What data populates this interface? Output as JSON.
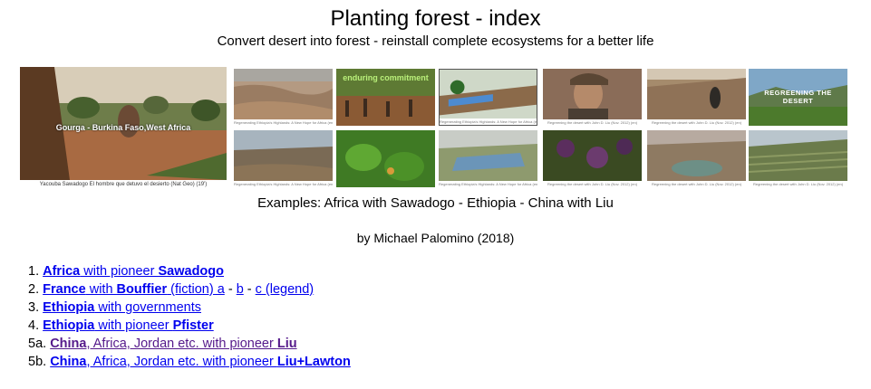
{
  "header": {
    "title": "Planting forest - index",
    "subtitle": "Convert desert into forest - reinstall complete ecosystems for a better life"
  },
  "hero": {
    "overlay_text": "Gourga - Burkina Faso,West Africa",
    "caption": "Yacouba Sawadogo El hombre que detuvo el desierto (Nat Geo)  (19')"
  },
  "thumbs": [
    {
      "caption": "Regenerating Ethiopia's Highlands: A New Hope for Africa (en)"
    },
    {
      "caption": "",
      "overlay": "enduring commitment"
    },
    {
      "caption": "Regenerating Ethiopia's Highlands: A New Hope for Africa (en)"
    },
    {
      "caption": "Regreening the desert with John D. Liu (Nov. 2012) (en)"
    },
    {
      "caption": "Regreening the desert with John D. Liu (Nov. 2012) (en)"
    },
    {
      "caption": "",
      "overlay": "REGREENING THE DESERT"
    },
    {
      "caption": "Regenerating Ethiopia's Highlands: A New Hope for Africa (en)"
    },
    {
      "caption": ""
    },
    {
      "caption": "Regenerating Ethiopia's Highlands: A New Hope for Africa (en)"
    },
    {
      "caption": "Regreening the desert with John D. Liu (Nov. 2012) (en)"
    },
    {
      "caption": "Regreening the desert with John D. Liu (Nov. 2012) (en)"
    },
    {
      "caption": "Regreening the desert with John D. Liu (Nov. 2012) (en)"
    }
  ],
  "examples": "Examples: Africa with Sawadogo - Ethiopia - China with Liu",
  "byline": "by Michael Palomino (2018)",
  "list": [
    {
      "num": "1.",
      "parts": [
        "Africa",
        " with pioneer ",
        "Sawadogo"
      ]
    },
    {
      "num": "2.",
      "parts": [
        "France",
        " with ",
        "Bouffier",
        " (fiction) a",
        " - ",
        "b",
        " - ",
        "c (legend)"
      ]
    },
    {
      "num": "3.",
      "parts": [
        "Ethiopia",
        " with governments"
      ]
    },
    {
      "num": "4.",
      "parts": [
        "Ethiopia",
        " with pioneer ",
        "Pfister"
      ]
    },
    {
      "num": "5a.",
      "parts": [
        "China",
        ", Africa, Jordan etc. with pioneer ",
        "Liu"
      ]
    },
    {
      "num": "5b.",
      "parts": [
        "China",
        ", Africa, Jordan etc. with pioneer ",
        "Liu+Lawton"
      ]
    }
  ],
  "colors": {
    "link": "#0000ee",
    "visited": "#551a8b"
  }
}
